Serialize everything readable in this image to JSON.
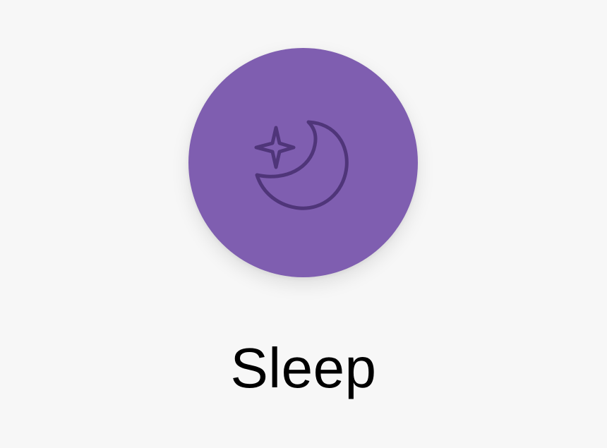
{
  "mode": {
    "label": "Sleep",
    "icon": "moon-stars-icon",
    "colors": {
      "background": "#f7f7f7",
      "circle": "#7f5eb0",
      "icon_stroke": "#4f3579",
      "label": "#000000"
    }
  }
}
